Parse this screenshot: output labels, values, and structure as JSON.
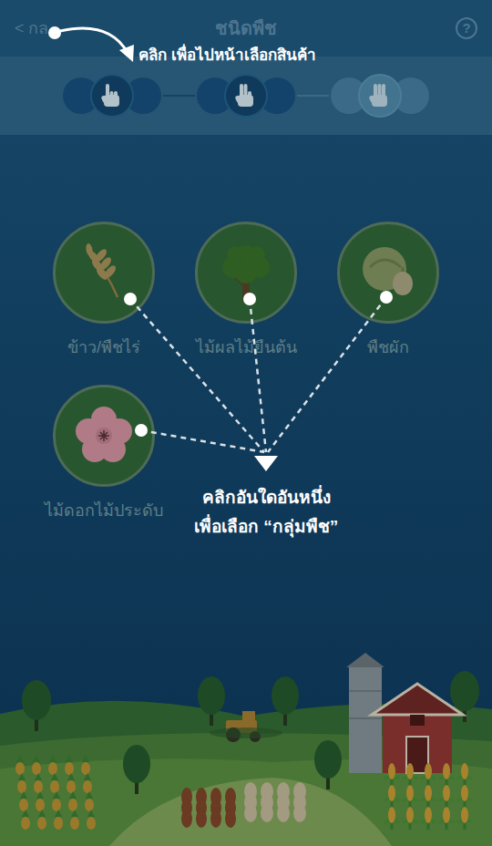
{
  "header": {
    "back_icon": "<",
    "back_label": "กล",
    "title": "ชนิดพืช",
    "help_icon": "?"
  },
  "steps": [
    {
      "kind": "one",
      "active": true
    },
    {
      "kind": "two",
      "active": true
    },
    {
      "kind": "three",
      "active": false
    }
  ],
  "categories": [
    {
      "label": "ข้าว/พืชไร่",
      "kind": "rice"
    },
    {
      "label": "ไม้ผลไม้ยืนต้น",
      "kind": "tree"
    },
    {
      "label": "พืชผัก",
      "kind": "vegetable"
    },
    {
      "label": "ไม้ดอกไม้ประดับ",
      "kind": "flower"
    }
  ],
  "tutorial": {
    "back_hint": "คลิก เพื่อไปหน้าเลือกสินค้า",
    "category_hint": [
      "คลิกอันใดอันหนึ่ง",
      "เพื่อเลือก “กลุ่มพืช”"
    ]
  }
}
